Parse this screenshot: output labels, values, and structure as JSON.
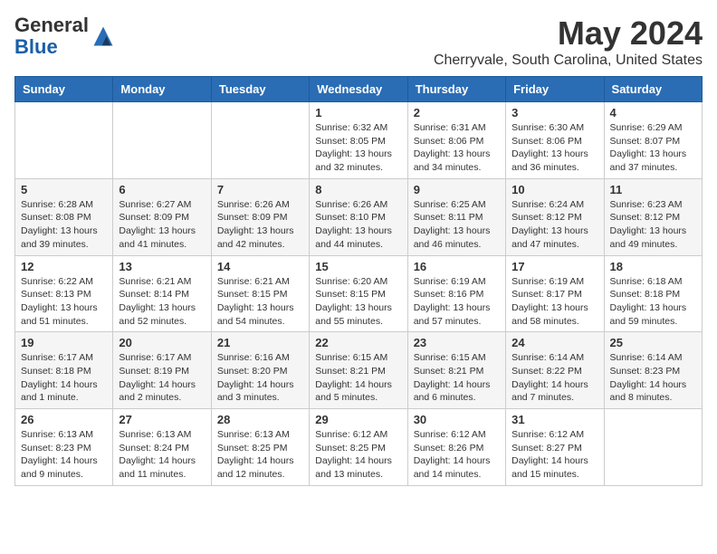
{
  "header": {
    "logo_general": "General",
    "logo_blue": "Blue",
    "main_title": "May 2024",
    "subtitle": "Cherryvale, South Carolina, United States"
  },
  "days_of_week": [
    "Sunday",
    "Monday",
    "Tuesday",
    "Wednesday",
    "Thursday",
    "Friday",
    "Saturday"
  ],
  "weeks": [
    [
      {
        "day": "",
        "info": ""
      },
      {
        "day": "",
        "info": ""
      },
      {
        "day": "",
        "info": ""
      },
      {
        "day": "1",
        "info": "Sunrise: 6:32 AM\nSunset: 8:05 PM\nDaylight: 13 hours\nand 32 minutes."
      },
      {
        "day": "2",
        "info": "Sunrise: 6:31 AM\nSunset: 8:06 PM\nDaylight: 13 hours\nand 34 minutes."
      },
      {
        "day": "3",
        "info": "Sunrise: 6:30 AM\nSunset: 8:06 PM\nDaylight: 13 hours\nand 36 minutes."
      },
      {
        "day": "4",
        "info": "Sunrise: 6:29 AM\nSunset: 8:07 PM\nDaylight: 13 hours\nand 37 minutes."
      }
    ],
    [
      {
        "day": "5",
        "info": "Sunrise: 6:28 AM\nSunset: 8:08 PM\nDaylight: 13 hours\nand 39 minutes."
      },
      {
        "day": "6",
        "info": "Sunrise: 6:27 AM\nSunset: 8:09 PM\nDaylight: 13 hours\nand 41 minutes."
      },
      {
        "day": "7",
        "info": "Sunrise: 6:26 AM\nSunset: 8:09 PM\nDaylight: 13 hours\nand 42 minutes."
      },
      {
        "day": "8",
        "info": "Sunrise: 6:26 AM\nSunset: 8:10 PM\nDaylight: 13 hours\nand 44 minutes."
      },
      {
        "day": "9",
        "info": "Sunrise: 6:25 AM\nSunset: 8:11 PM\nDaylight: 13 hours\nand 46 minutes."
      },
      {
        "day": "10",
        "info": "Sunrise: 6:24 AM\nSunset: 8:12 PM\nDaylight: 13 hours\nand 47 minutes."
      },
      {
        "day": "11",
        "info": "Sunrise: 6:23 AM\nSunset: 8:12 PM\nDaylight: 13 hours\nand 49 minutes."
      }
    ],
    [
      {
        "day": "12",
        "info": "Sunrise: 6:22 AM\nSunset: 8:13 PM\nDaylight: 13 hours\nand 51 minutes."
      },
      {
        "day": "13",
        "info": "Sunrise: 6:21 AM\nSunset: 8:14 PM\nDaylight: 13 hours\nand 52 minutes."
      },
      {
        "day": "14",
        "info": "Sunrise: 6:21 AM\nSunset: 8:15 PM\nDaylight: 13 hours\nand 54 minutes."
      },
      {
        "day": "15",
        "info": "Sunrise: 6:20 AM\nSunset: 8:15 PM\nDaylight: 13 hours\nand 55 minutes."
      },
      {
        "day": "16",
        "info": "Sunrise: 6:19 AM\nSunset: 8:16 PM\nDaylight: 13 hours\nand 57 minutes."
      },
      {
        "day": "17",
        "info": "Sunrise: 6:19 AM\nSunset: 8:17 PM\nDaylight: 13 hours\nand 58 minutes."
      },
      {
        "day": "18",
        "info": "Sunrise: 6:18 AM\nSunset: 8:18 PM\nDaylight: 13 hours\nand 59 minutes."
      }
    ],
    [
      {
        "day": "19",
        "info": "Sunrise: 6:17 AM\nSunset: 8:18 PM\nDaylight: 14 hours\nand 1 minute."
      },
      {
        "day": "20",
        "info": "Sunrise: 6:17 AM\nSunset: 8:19 PM\nDaylight: 14 hours\nand 2 minutes."
      },
      {
        "day": "21",
        "info": "Sunrise: 6:16 AM\nSunset: 8:20 PM\nDaylight: 14 hours\nand 3 minutes."
      },
      {
        "day": "22",
        "info": "Sunrise: 6:15 AM\nSunset: 8:21 PM\nDaylight: 14 hours\nand 5 minutes."
      },
      {
        "day": "23",
        "info": "Sunrise: 6:15 AM\nSunset: 8:21 PM\nDaylight: 14 hours\nand 6 minutes."
      },
      {
        "day": "24",
        "info": "Sunrise: 6:14 AM\nSunset: 8:22 PM\nDaylight: 14 hours\nand 7 minutes."
      },
      {
        "day": "25",
        "info": "Sunrise: 6:14 AM\nSunset: 8:23 PM\nDaylight: 14 hours\nand 8 minutes."
      }
    ],
    [
      {
        "day": "26",
        "info": "Sunrise: 6:13 AM\nSunset: 8:23 PM\nDaylight: 14 hours\nand 9 minutes."
      },
      {
        "day": "27",
        "info": "Sunrise: 6:13 AM\nSunset: 8:24 PM\nDaylight: 14 hours\nand 11 minutes."
      },
      {
        "day": "28",
        "info": "Sunrise: 6:13 AM\nSunset: 8:25 PM\nDaylight: 14 hours\nand 12 minutes."
      },
      {
        "day": "29",
        "info": "Sunrise: 6:12 AM\nSunset: 8:25 PM\nDaylight: 14 hours\nand 13 minutes."
      },
      {
        "day": "30",
        "info": "Sunrise: 6:12 AM\nSunset: 8:26 PM\nDaylight: 14 hours\nand 14 minutes."
      },
      {
        "day": "31",
        "info": "Sunrise: 6:12 AM\nSunset: 8:27 PM\nDaylight: 14 hours\nand 15 minutes."
      },
      {
        "day": "",
        "info": ""
      }
    ]
  ]
}
